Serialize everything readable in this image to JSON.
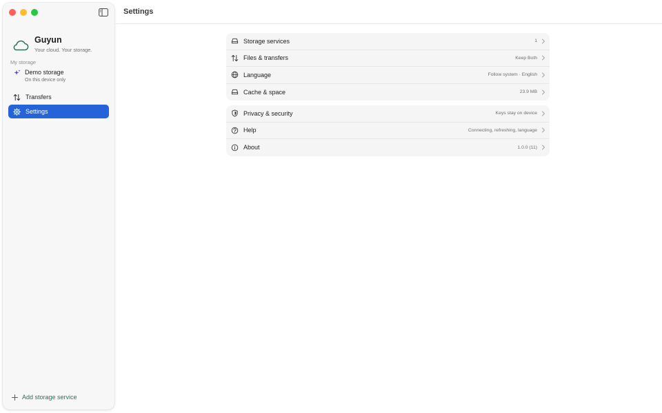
{
  "app": {
    "name": "Guyun",
    "tagline": "Your cloud. Your storage."
  },
  "sidebar": {
    "section_label": "My storage",
    "storage_items": [
      {
        "name": "Demo storage",
        "subtitle": "On this device only"
      }
    ],
    "nav": [
      {
        "label": "Transfers",
        "icon": "arrows-up-down-icon"
      },
      {
        "label": "Settings",
        "icon": "gear-icon",
        "active": true
      }
    ],
    "add_service_label": "Add storage service"
  },
  "header": {
    "title": "Settings"
  },
  "settings": {
    "group1": [
      {
        "label": "Storage services",
        "value": "1",
        "icon": "drive-icon"
      },
      {
        "label": "Files & transfers",
        "value": "Keep Both",
        "icon": "arrows-up-down-icon"
      },
      {
        "label": "Language",
        "value": "Follow system · English",
        "icon": "globe-icon"
      },
      {
        "label": "Cache & space",
        "value": "23.9 MB",
        "icon": "drive-icon"
      }
    ],
    "group2": [
      {
        "label": "Privacy & security",
        "value": "Keys stay on device",
        "icon": "shield-icon"
      },
      {
        "label": "Help",
        "value": "Connecting, refreshing, language",
        "icon": "question-circle-icon"
      },
      {
        "label": "About",
        "value": "1.0.0 (11)",
        "icon": "info-circle-icon"
      }
    ]
  },
  "colors": {
    "accent": "#2563d9",
    "brand_green": "#2f6f5e",
    "sidebar_bg": "#f7f7f8",
    "group_bg": "#f5f5f6"
  }
}
